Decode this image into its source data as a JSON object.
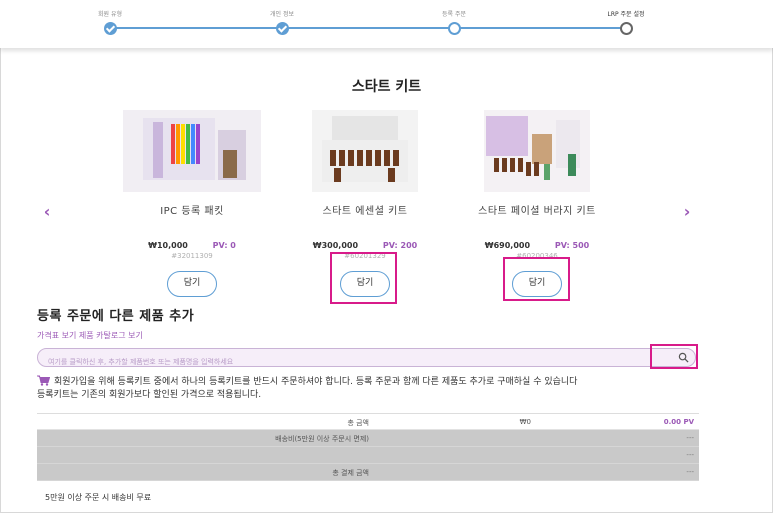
{
  "stepper": {
    "steps": [
      {
        "label": "회원 유형",
        "state": "done"
      },
      {
        "label": "개인 정보",
        "state": "done"
      },
      {
        "label": "등록 주문",
        "state": "current"
      },
      {
        "label": "LRP 주문 설정",
        "state": "todo"
      }
    ]
  },
  "kit_section": {
    "title": "스타트 키트",
    "products": [
      {
        "name": "IPC 등록 패킷",
        "price": "₩10,000",
        "pv": "PV: 0",
        "sku": "#32011309",
        "add_label": "담기"
      },
      {
        "name": "스타트 에센셜 키트",
        "price": "₩300,000",
        "pv": "PV: 200",
        "sku": "#60201329",
        "add_label": "담기"
      },
      {
        "name": "스타트 페이셜 버라지 키트",
        "price": "₩690,000",
        "pv": "PV: 500",
        "sku": "#60200346",
        "add_label": "담기"
      }
    ]
  },
  "add_products": {
    "title": "등록 주문에 다른 제품 추가",
    "catalog_link": "가격표 보기 제품 카탈로그 보기",
    "search_placeholder": "여기를 클릭하신 후, 추가할 제품번호 또는 제품명을 입력하세요"
  },
  "notice": {
    "line1": "회원가입을 위해 등록키트 중에서 하나의 등록키트를 반드시 주문하셔야 합니다. 등록 주문과 함께 다른 제품도 추가로 구매하실 수 있습니다",
    "line2": "등록키트는 기존의 회원가보다 할인된 가격으로 적용됩니다."
  },
  "totals": {
    "total_label": "총 금액",
    "total_amount": "₩0",
    "total_pv": "0.00 PV",
    "shipping_label": "배송비(5만원 이상 주문시 면제)",
    "shipping_value": "---",
    "blank_value": "---",
    "grand_total_label": "총 결제 금액",
    "grand_total_value": "---"
  },
  "footnote": "5만원 이상 주문 시 배송비 무료",
  "colors": {
    "accent_blue": "#5f9ed4",
    "accent_purple": "#9b59b6",
    "highlight": "#d81b8a"
  }
}
